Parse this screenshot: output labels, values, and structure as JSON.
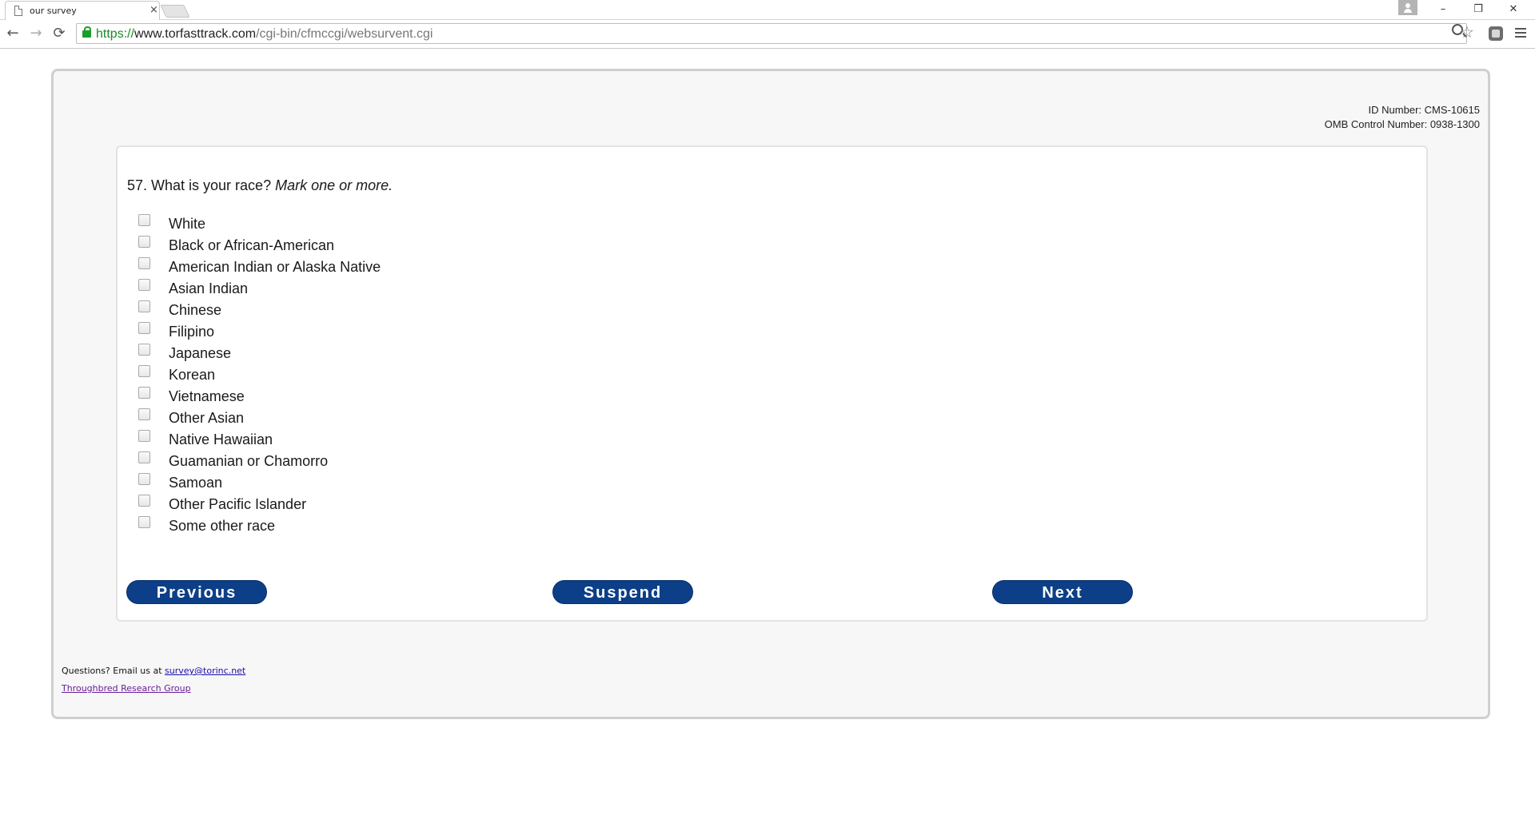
{
  "browser": {
    "tab_title": "our survey",
    "tab_close": "×",
    "url_scheme": "https://",
    "url_host": "www.torfasttrack.com",
    "url_path": "/cgi-bin/cfmccgi/websurvent.cgi",
    "back_glyph": "←",
    "forward_glyph": "→",
    "reload_glyph": "⟳",
    "star_glyph": "☆",
    "minimize_glyph": "–",
    "restore_glyph": "❐",
    "close_glyph": "✕"
  },
  "header": {
    "id_number": "ID Number: CMS-10615",
    "omb_number": "OMB Control Number: 0938-1300"
  },
  "question": {
    "text": "57. What is your race?",
    "instruction": "Mark one or more.",
    "options": [
      "White",
      "Black or African-American",
      "American Indian or Alaska Native",
      "Asian Indian",
      "Chinese",
      "Filipino",
      "Japanese",
      "Korean",
      "Vietnamese",
      "Other Asian",
      "Native Hawaiian",
      "Guamanian or Chamorro",
      "Samoan",
      "Other Pacific Islander",
      "Some other race"
    ]
  },
  "buttons": {
    "previous": "Previous",
    "suspend": "Suspend",
    "next": "Next"
  },
  "footer": {
    "questions_text": "Questions? Email us at",
    "email": "survey@torinc.net",
    "org_link": "Throughbred Research Group"
  },
  "colors": {
    "button_bg": "#0c3f87",
    "link": "#1a0dab",
    "visited_link": "#6a1b9a"
  }
}
